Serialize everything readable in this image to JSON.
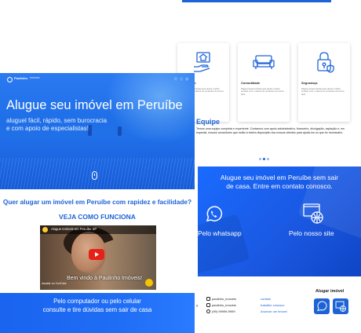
{
  "hero": {
    "logo_text": "Paulinho",
    "logo_sub": "Imóveis",
    "social": "ⓕ ⓘ ⓦ",
    "title": "Alugue seu imóvel em Peruíbe",
    "subtitle_line1": "aluguel fácil, rápido, sem burocracia",
    "subtitle_line2": "e com apoio de especialistas!"
  },
  "intro": {
    "question": "Quer alugar um imóvel em Peruíbe com rapidez e facilidade?",
    "veja": "VEJA COMO FUNCIONA"
  },
  "video": {
    "title": "Alugue Imóveis em Peruíbe SP",
    "caption": "Bem vindo à Paulinho Imóveis!",
    "bottom": "Assistir no YouTube"
  },
  "bottom_band": {
    "line1": "Pelo computador ou pelo celular",
    "line2": "consulte e tire dúvidas sem sair de casa"
  },
  "features": [
    {
      "title": "Facilidade",
      "desc": "Página desenvolvida para deixar melhor contato com o cliente do vendedor de forma fácil."
    },
    {
      "title": "Comodidade",
      "desc": "Página desenvolvida para deixar melhor contato com o cliente do vendedor de forma fácil."
    },
    {
      "title": "Segurança",
      "desc": "Página desenvolvida para deixar melhor contato com o cliente do vendedor de forma fácil."
    }
  ],
  "team": {
    "title": "Equipe",
    "text": "Temos uma equipe completa e experiente. Contamos com apoio administrativo, financeiro, divulgação, captação e, em especial, nossos consultores que estão à inteira disposição dos nossos clientes para ajudá-los no que for necessário."
  },
  "contact": {
    "heading_line1": "Alugue seu imóvel em Peruíbe sem sair",
    "heading_line2": "de casa. Entre em contato conosco.",
    "whatsapp_label": "Pelo whatsapp",
    "site_label": "Pelo nosso site"
  },
  "footer": {
    "social": [
      "paulinho_imoveis",
      "paulinho_imoveis",
      "(99) 99999-9999"
    ],
    "links": [
      "contato",
      "trabalhe conosco",
      "Anuncie um imóvel"
    ],
    "alugar_title": "Alugar imóvel"
  },
  "colors": {
    "brand_blue": "#1e63d6",
    "accent_yellow": "#f5c400"
  }
}
